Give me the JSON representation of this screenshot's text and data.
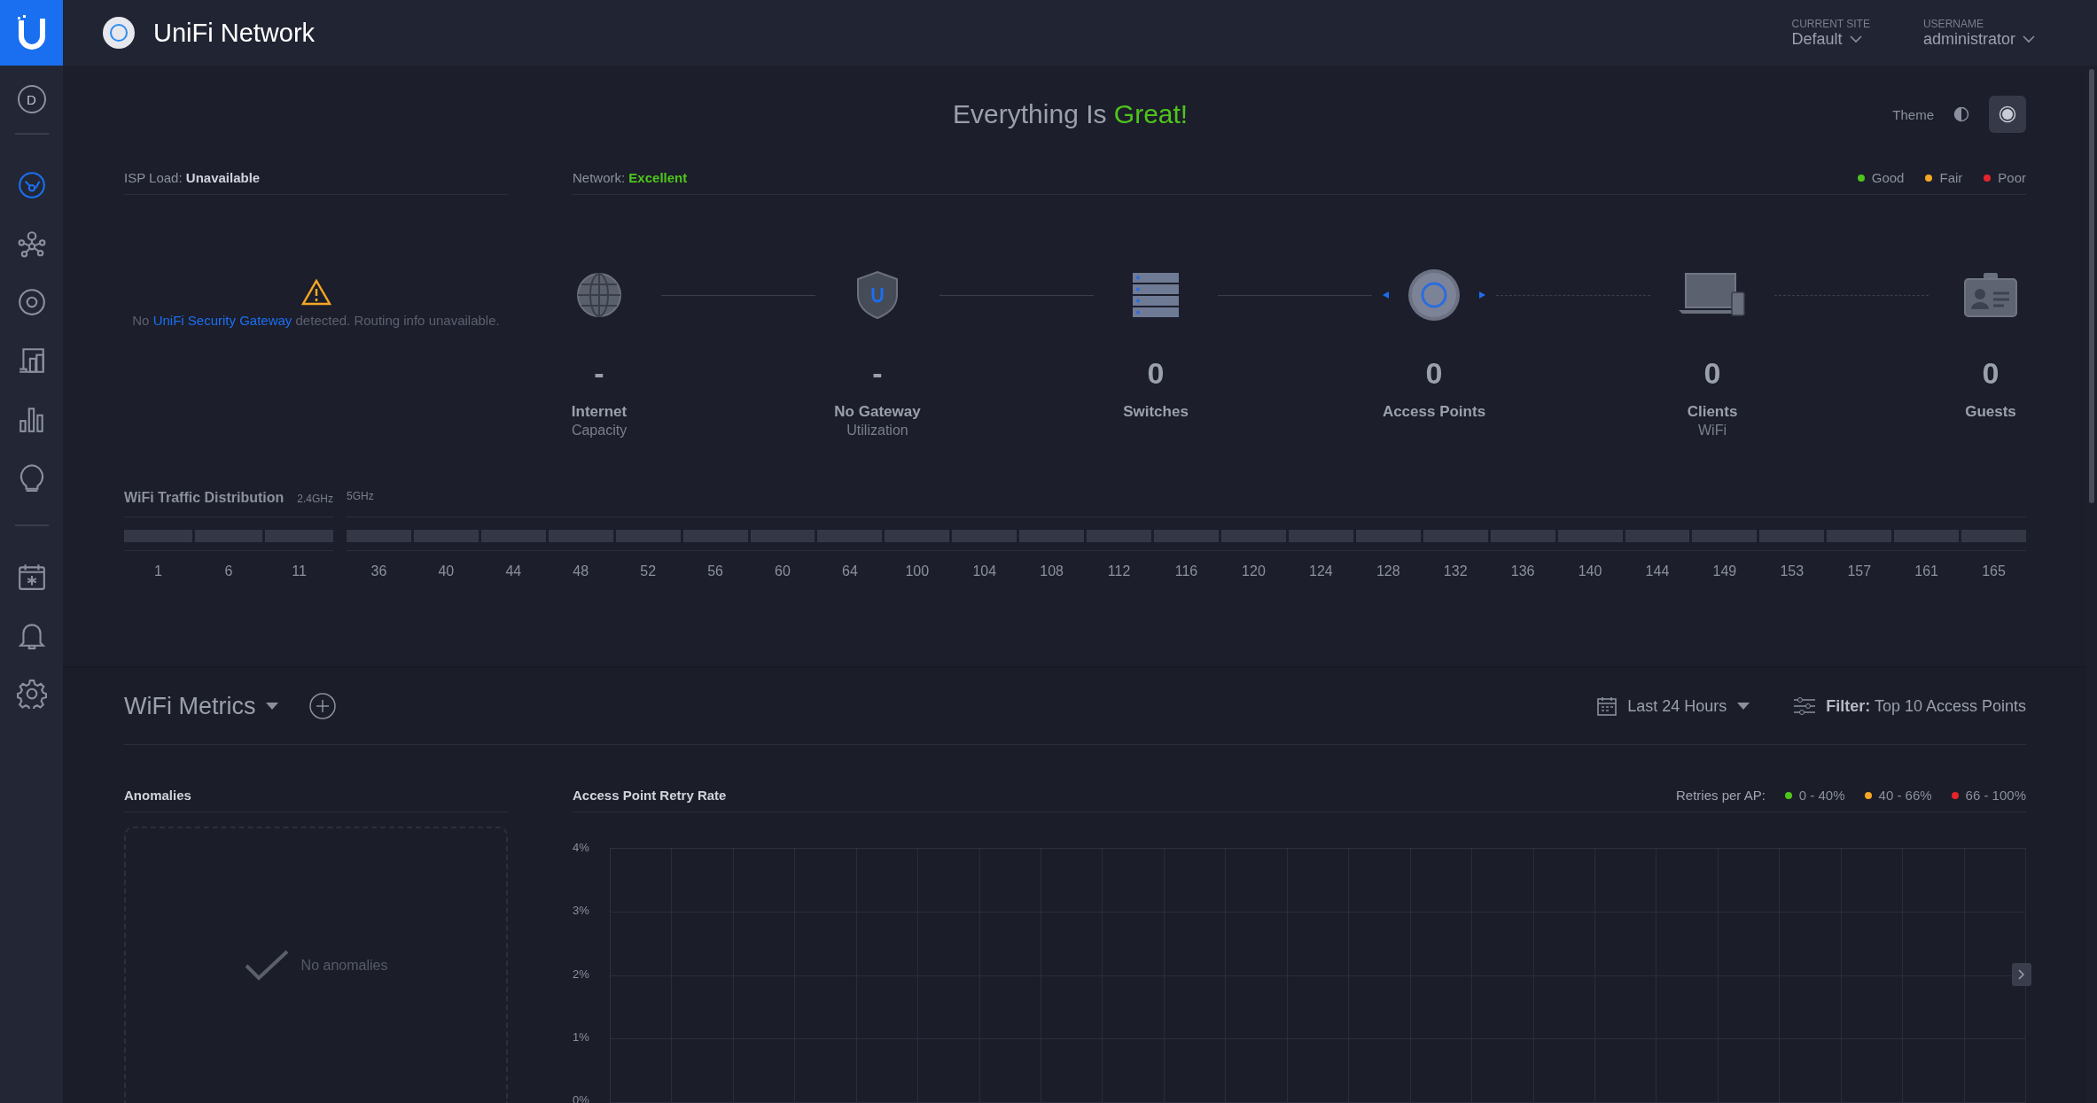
{
  "topbar": {
    "app_name": "UniFi Network",
    "site_label": "CURRENT SITE",
    "site": "Default",
    "user_label": "USERNAME",
    "user": "administrator"
  },
  "sidebar": {
    "avatar": "D",
    "items": [
      {
        "kind": "dashboard",
        "selected": true
      },
      {
        "kind": "topology",
        "selected": false
      },
      {
        "kind": "devices",
        "selected": false
      },
      {
        "kind": "clients",
        "selected": false
      },
      {
        "kind": "statistics",
        "selected": false
      },
      {
        "kind": "insights",
        "selected": false
      },
      {
        "kind": "divider"
      },
      {
        "kind": "events",
        "selected": false
      },
      {
        "kind": "alerts",
        "selected": false
      },
      {
        "kind": "settings",
        "selected": false
      }
    ]
  },
  "status": {
    "text": "Everything Is",
    "highlight": "Great!"
  },
  "theme": {
    "label": "Theme",
    "options": [
      {
        "kind": "light",
        "selected": false
      },
      {
        "kind": "dark",
        "selected": true
      }
    ]
  },
  "isp": {
    "label": "ISP Load:",
    "value": "Unavailable",
    "message_before": "No",
    "link": "UniFi Security Gateway",
    "message_after": "detected. Routing info unavailable."
  },
  "network": {
    "label": "Network:",
    "value": "Excellent"
  },
  "legend": [
    {
      "label": "Good",
      "color": "#4ec51b"
    },
    {
      "label": "Fair",
      "color": "#f5a623"
    },
    {
      "label": "Poor",
      "color": "#e5252d"
    }
  ],
  "topology": [
    {
      "kind": "internet",
      "value": "-",
      "label": "Internet",
      "sublabel": "Capacity"
    },
    {
      "kind": "gateway",
      "wireless": false,
      "value": "-",
      "label": "No Gateway",
      "sublabel": "Utilization"
    },
    {
      "kind": "switch",
      "wireless": false,
      "value": "0",
      "label": "Switches"
    },
    {
      "kind": "access-point",
      "wireless": false,
      "value": "0",
      "label": "Access Points"
    },
    {
      "kind": "client",
      "wireless": true,
      "value": "0",
      "label": "Clients",
      "sublabel": "WiFi"
    },
    {
      "kind": "guest",
      "wireless": true,
      "value": "0",
      "label": "Guests"
    }
  ],
  "wifi_traffic": {
    "title": "WiFi Traffic Distribution",
    "bands": [
      {
        "label": "2.4GHz",
        "channels": [
          "1",
          "6",
          "11"
        ]
      },
      {
        "label": "5GHz",
        "channels": [
          "36",
          "40",
          "44",
          "48",
          "52",
          "56",
          "60",
          "64",
          "100",
          "104",
          "108",
          "112",
          "116",
          "120",
          "124",
          "128",
          "132",
          "136",
          "140",
          "144",
          "149",
          "153",
          "157",
          "161",
          "165"
        ]
      }
    ]
  },
  "metrics": {
    "title": "WiFi Metrics",
    "range": "Last 24 Hours",
    "filter_label": "Filter:",
    "filter_value": "Top 10 Access Points"
  },
  "anomalies": {
    "title": "Anomalies",
    "empty": "No anomalies"
  },
  "retry": {
    "title": "Access Point Retry Rate",
    "legend_label": "Retries per AP:",
    "legend": [
      {
        "label": "0 - 40%",
        "color": "#4ec51b"
      },
      {
        "label": "40 - 66%",
        "color": "#f5a623"
      },
      {
        "label": "66 - 100%",
        "color": "#e5252d"
      }
    ],
    "y_axis_labels": [
      "4%",
      "3%",
      "2%",
      "1%",
      "0%"
    ]
  }
}
